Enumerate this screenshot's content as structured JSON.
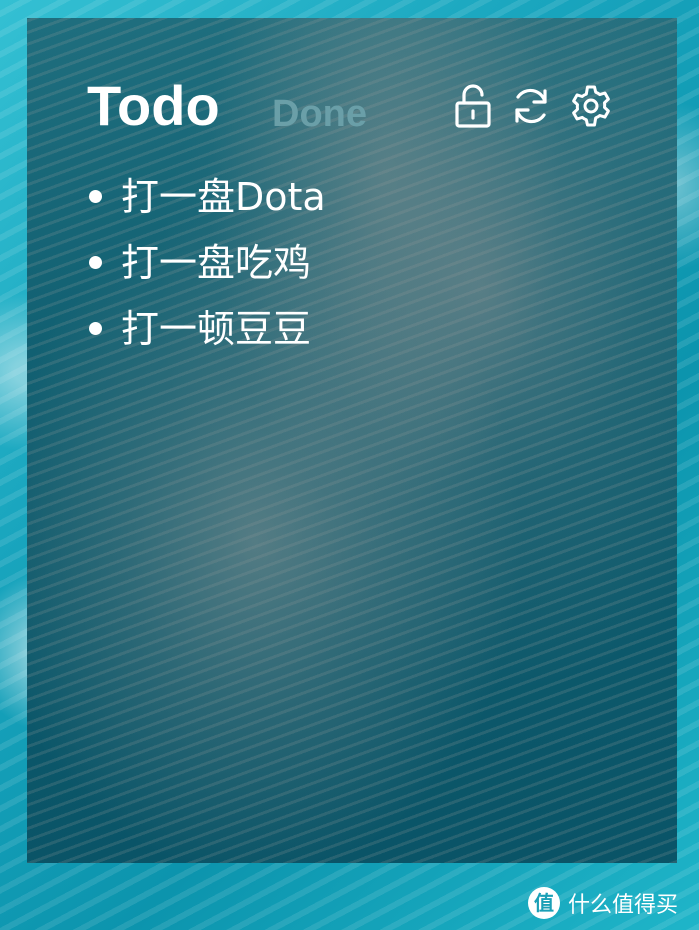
{
  "header": {
    "todo_tab": "Todo",
    "done_tab": "Done"
  },
  "toolbar": {
    "icons": [
      "unlock-icon",
      "refresh-icon",
      "gear-icon"
    ]
  },
  "todo_items": [
    "打一盘Dota",
    "打一盘吃鸡",
    "打一顿豆豆"
  ],
  "watermark": {
    "logo_text": "值",
    "site_name": "什么值得买"
  },
  "colors": {
    "active_tab": "#ffffff",
    "inactive_tab": "#6a9fa8",
    "panel_tint": "#0f5e70"
  }
}
